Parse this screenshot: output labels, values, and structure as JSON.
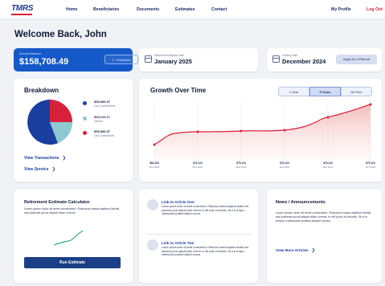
{
  "nav": {
    "logo": "TMRS",
    "links": [
      "Home",
      "Beneficiaries",
      "Documents",
      "Estimates",
      "Contact"
    ],
    "profile": "My Profile",
    "logout": "Log Out"
  },
  "welcome": "Welcome Back, John",
  "balance": {
    "label": "Account Balance",
    "value": "$158,708.49",
    "download": "Download"
  },
  "retirement_date": {
    "label": "Retirement Eligible Date",
    "value": "January 2025"
  },
  "vesting_date": {
    "label": "Vesting Date",
    "value": "December 2024",
    "refund_button": "Apply for a Refund"
  },
  "breakdown": {
    "title": "Breakdown",
    "items": [
      {
        "amount": "$95,985.37",
        "label": "Your Contributions",
        "color": "#1a3f9e"
      },
      {
        "amount": "$43,123.17",
        "label": "Interest",
        "color": "#8ec9d1"
      },
      {
        "amount": "$95,985.37",
        "label": "City Contributions",
        "color": "#d8203a"
      }
    ],
    "view_transactions": "View Transactions",
    "view_service": "View Service"
  },
  "growth": {
    "title": "Growth Over Time",
    "tabs": [
      "1 Year",
      "5 Years",
      "All Time"
    ],
    "active_tab": "5 Years",
    "x_points": [
      {
        "value": "$64,326",
        "date": "Mar 2020"
      },
      {
        "value": "$70,124",
        "date": "Mar 2021"
      },
      {
        "value": "$75,124",
        "date": "Mar 2022"
      },
      {
        "value": "$75,124",
        "date": "Mar 2023"
      },
      {
        "value": "$75,124",
        "date": "Mar 2024"
      },
      {
        "value": "$75,124",
        "date": "Jan 2025"
      }
    ],
    "line_color": "#d8203a"
  },
  "calculator": {
    "title": "Retirement Estimate Calculator",
    "body": "Lorem ipsum dolor sit amet consectetur. Ridiculus massa dapibus facilisi sed placerat purus aliquet diam viverra.",
    "run_button": "Run Estimate"
  },
  "articles": [
    {
      "title": "Link to Article One",
      "body": "Lorem ipsum dolor sit amet consectetur. Ridiculus massa dapibus facilisi sed placerat purus aliquet diam viverra. In elit proin et lobortis. Sit a in tempor malesuada sodales aliquet cursus."
    },
    {
      "title": "Link to Article Two",
      "body": "Lorem ipsum dolor sit amet consectetur. Ridiculus massa dapibus facilisi sed placerat purus aliquet diam viverra. In elit proin et lobortis. Sit a in tempor malesuada sodales aliquet cursus."
    }
  ],
  "news": {
    "title": "News / Announcements",
    "body": "Lorem ipsum dolor sit amet consectetur. Ridiculus massa dapibus facilisi sed placerat purus aliquet diam viverra. In elit proin et lobortis. Sit a in tempor malesuada sodales aliquet cursus.",
    "link": "View More Articles"
  }
}
